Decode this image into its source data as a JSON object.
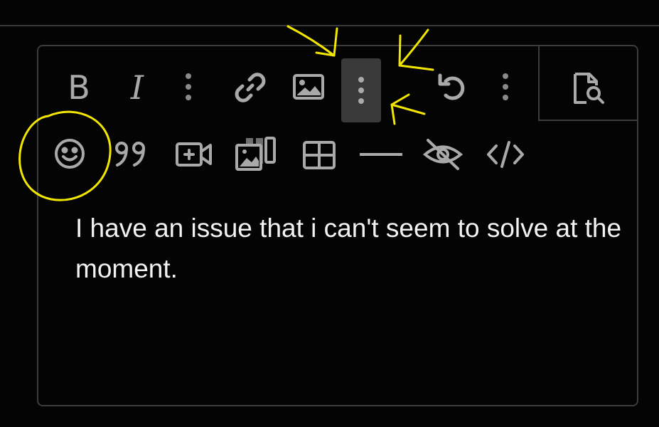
{
  "toolbar": {
    "bold_label": "B",
    "italic_label": "I",
    "row1_icons": [
      "more-options-icon",
      "link-icon",
      "image-icon",
      "more-options-icon",
      "undo-icon",
      "more-options-icon",
      "preview-icon"
    ],
    "row2_icons": [
      "emoji-icon",
      "quote-icon",
      "video-icon",
      "gallery-icon",
      "table-icon",
      "horizontal-rule-icon",
      "spoiler-hidden-icon",
      "code-icon"
    ],
    "active_item": "more-options-icon (second)"
  },
  "editor": {
    "content": "I have an issue that i can't seem to solve at the moment."
  },
  "annotation": {
    "color": "#f2e600",
    "marks": [
      "arrows-pointing-to-more-options",
      "circle-around-emoji-button"
    ]
  },
  "colors": {
    "background": "#040404",
    "icon": "#a9a9a9",
    "border": "#3c3c3c",
    "text": "#f2f2f2",
    "active_bg": "#3a3a3a"
  }
}
